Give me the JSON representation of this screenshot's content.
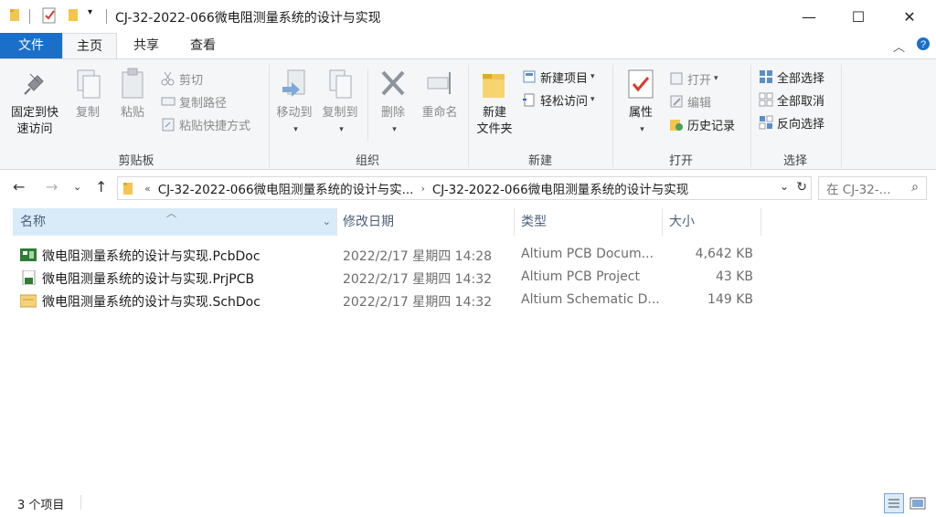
{
  "window": {
    "title": "CJ-32-2022-066微电阻测量系统的设计与实现",
    "controls": {
      "minimize": "—",
      "maximize": "☐",
      "close": "✕"
    }
  },
  "ribbon_tabs": {
    "file": "文件",
    "home": "主页",
    "share": "共享",
    "view": "查看"
  },
  "ribbon": {
    "clipboard": {
      "pin": "固定到快速访问",
      "pin_line1": "固定到快",
      "pin_line2": "速访问",
      "copy": "复制",
      "paste": "粘贴",
      "cut": "剪切",
      "copy_path": "复制路径",
      "paste_shortcut": "粘贴快捷方式",
      "label": "剪贴板"
    },
    "organize": {
      "move_to": "移动到",
      "copy_to": "复制到",
      "delete": "删除",
      "rename": "重命名",
      "label": "组织"
    },
    "new": {
      "new_folder_line1": "新建",
      "new_folder_line2": "文件夹",
      "new_item": "新建项目",
      "easy_access": "轻松访问",
      "label": "新建"
    },
    "open": {
      "properties": "属性",
      "open": "打开",
      "edit": "编辑",
      "history": "历史记录",
      "label": "打开"
    },
    "select": {
      "select_all": "全部选择",
      "select_none": "全部取消",
      "invert": "反向选择",
      "label": "选择"
    }
  },
  "address": {
    "overflow": "«",
    "crumbs": [
      "CJ-32-2022-066微电阻测量系统的设计与实...",
      "CJ-32-2022-066微电阻测量系统的设计与实现"
    ],
    "search_placeholder": "在 CJ-32-..."
  },
  "columns": {
    "name": "名称",
    "modified": "修改日期",
    "type": "类型",
    "size": "大小"
  },
  "files": [
    {
      "name": "微电阻测量系统的设计与实现.PcbDoc",
      "modified": "2022/2/17 星期四 14:28",
      "type": "Altium PCB Docum...",
      "size": "4,642 KB",
      "icon": "pcb-doc-icon"
    },
    {
      "name": "微电阻测量系统的设计与实现.PrjPCB",
      "modified": "2022/2/17 星期四 14:32",
      "type": "Altium PCB Project",
      "size": "43 KB",
      "icon": "pcb-project-icon"
    },
    {
      "name": "微电阻测量系统的设计与实现.SchDoc",
      "modified": "2022/2/17 星期四 14:32",
      "type": "Altium Schematic D...",
      "size": "149 KB",
      "icon": "schematic-doc-icon"
    }
  ],
  "status": {
    "count": "3 个项目"
  },
  "colors": {
    "accent": "#1a6fc9",
    "selected_header": "#d9ebf9",
    "folder": "#f2c550"
  }
}
